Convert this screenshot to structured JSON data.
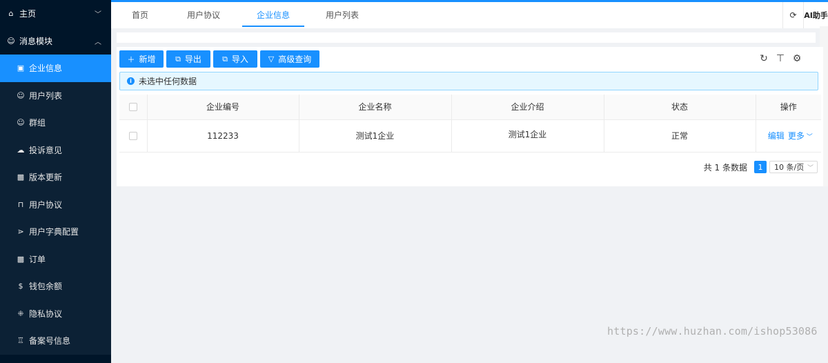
{
  "sidebar": {
    "home": {
      "label": "主页",
      "icon": "home-icon"
    },
    "module": {
      "label": "消息模块",
      "icon": "message-icon"
    },
    "items": [
      {
        "label": "企业信息",
        "icon": "company-icon",
        "active": true
      },
      {
        "label": "用户列表",
        "icon": "user-list-icon"
      },
      {
        "label": "群组",
        "icon": "group-icon"
      },
      {
        "label": "投诉意见",
        "icon": "cloud-icon"
      },
      {
        "label": "版本更新",
        "icon": "version-icon"
      },
      {
        "label": "用户协议",
        "icon": "user-agreement-icon"
      },
      {
        "label": "用户字典配置",
        "icon": "dictionary-icon"
      },
      {
        "label": "订单",
        "icon": "order-icon"
      },
      {
        "label": "钱包余额",
        "icon": "wallet-icon"
      },
      {
        "label": "隐私协议",
        "icon": "privacy-icon"
      },
      {
        "label": "备案号信息",
        "icon": "shirt-icon"
      }
    ]
  },
  "topbar": {
    "tabs": [
      {
        "label": "首页"
      },
      {
        "label": "用户协议"
      },
      {
        "label": "企业信息",
        "active": true
      },
      {
        "label": "用户列表"
      }
    ],
    "ai_label": "AI助手"
  },
  "toolbar": {
    "add_label": "新增",
    "export_label": "导出",
    "import_label": "导入",
    "search_label": "高级查询"
  },
  "alert": {
    "text": "未选中任何数据"
  },
  "table": {
    "headers": [
      "企业编号",
      "企业名称",
      "企业介绍",
      "状态",
      "操作"
    ],
    "rows": [
      {
        "id": "112233",
        "name": "测试1企业",
        "intro": "测试1企业",
        "status": "正常",
        "edit": "编辑",
        "more": "更多"
      }
    ]
  },
  "pagination": {
    "total_text": "共 1 条数据",
    "current_page": "1",
    "page_size": "10 条/页"
  },
  "watermark": "https://www.huzhan.com/ishop53086",
  "colors": {
    "primary": "#1890ff",
    "sidebar_bg": "#001529",
    "alert_bg": "#e6f7ff"
  }
}
